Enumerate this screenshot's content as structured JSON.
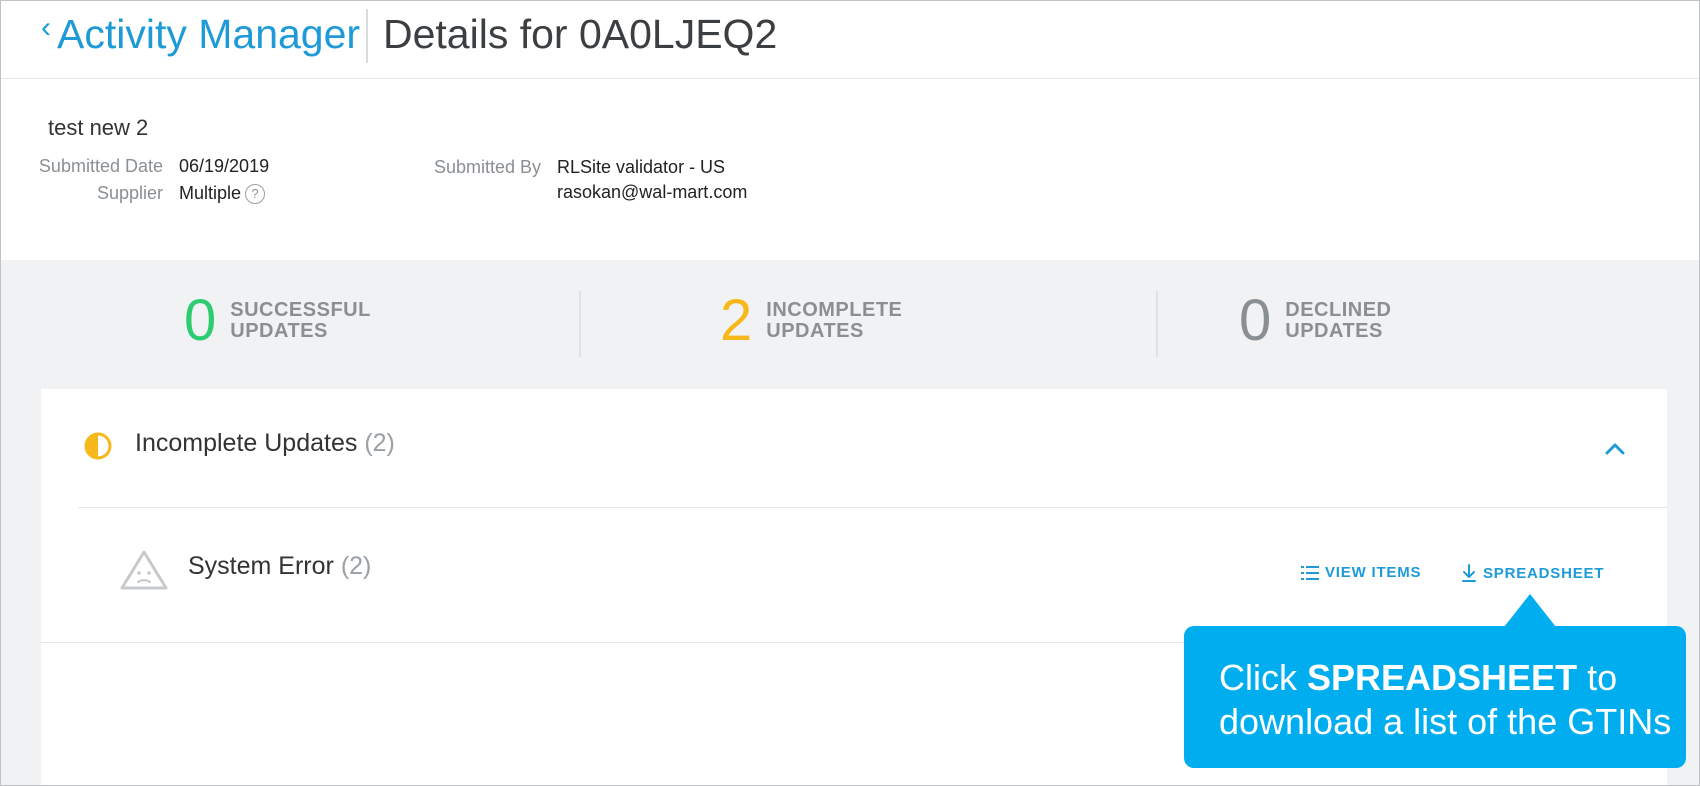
{
  "header": {
    "back_label": "Activity Manager",
    "title": "Details for 0A0LJEQ2"
  },
  "summary": {
    "name": "test new 2",
    "submitted_date_label": "Submitted Date",
    "submitted_date": "06/19/2019",
    "supplier_label": "Supplier",
    "supplier": "Multiple",
    "help_glyph": "?",
    "submitted_by_label": "Submitted By",
    "submitted_by_name": "RLSite validator - US",
    "submitted_by_email": "rasokan@wal-mart.com"
  },
  "stats": [
    {
      "count": "0",
      "line1": "SUCCESSFUL",
      "line2": "UPDATES",
      "color": "#2ecc71"
    },
    {
      "count": "2",
      "line1": "INCOMPLETE",
      "line2": "UPDATES",
      "color": "#f7b81c"
    },
    {
      "count": "0",
      "line1": "DECLINED",
      "line2": "UPDATES",
      "color": "#8a8f94"
    }
  ],
  "panel": {
    "title": "Incomplete Updates",
    "count": "(2)",
    "error_title": "System Error",
    "error_count": "(2)",
    "view_items_label": "VIEW ITEMS",
    "spreadsheet_label": "SPREADSHEET"
  },
  "callout": {
    "pre": "Click ",
    "bold": "SPREADSHEET",
    "post": " to",
    "line2": "download a list of the GTINs"
  },
  "colors": {
    "accent": "#1e9bd7",
    "callout_bg": "#00aeef",
    "incomplete": "#f7b81c",
    "success": "#2ecc71"
  }
}
